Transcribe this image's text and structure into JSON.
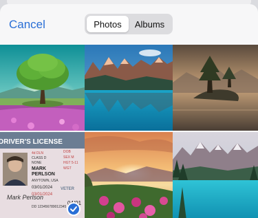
{
  "nav": {
    "cancel_label": "Cancel",
    "tabs": [
      {
        "label": "Photos",
        "selected": true
      },
      {
        "label": "Albums",
        "selected": false
      }
    ]
  },
  "photos": [
    {
      "name": "tree-meadow"
    },
    {
      "name": "mountain-lake"
    },
    {
      "name": "lone-tree-island"
    },
    {
      "name": "drivers-license",
      "selected": true,
      "header": "DRIVER'S LICENSE",
      "first_name": "MARK",
      "last_name": "PERLSON",
      "issue_date": "03/01/2024",
      "expiry_date": "04/01",
      "badge": "VETER"
    },
    {
      "name": "sunset-flowers"
    },
    {
      "name": "alpine-lake"
    }
  ],
  "colors": {
    "accent": "#2a6fd6"
  }
}
